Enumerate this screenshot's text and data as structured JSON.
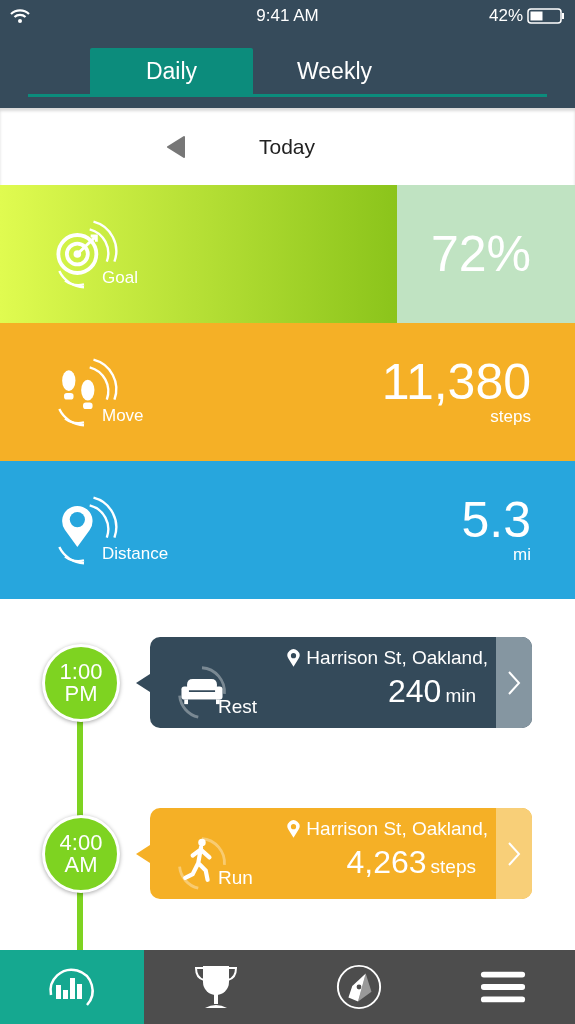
{
  "status_bar": {
    "time": "9:41 AM",
    "battery": "42%"
  },
  "tabs": [
    {
      "label": "Daily",
      "selected": true
    },
    {
      "label": "Weekly",
      "selected": false
    }
  ],
  "date_nav": {
    "label": "Today"
  },
  "metrics": [
    {
      "kind": "goal",
      "label": "Goal",
      "value": "72%",
      "level": 0.69
    },
    {
      "kind": "move",
      "label": "Move",
      "value": "11,380",
      "unit": "steps"
    },
    {
      "kind": "distance",
      "label": "Distance",
      "value": "5.3",
      "unit": "mi"
    }
  ],
  "timeline": [
    {
      "kind": "rest",
      "time": "1:00",
      "period": "PM",
      "label": "Rest",
      "location": "Harrison St, Oakland,",
      "value": "240",
      "unit": "min"
    },
    {
      "kind": "run",
      "time": "4:00",
      "period": "AM",
      "label": "Run",
      "location": "Harrison St, Oakland,",
      "value": "4,263",
      "unit": "steps"
    }
  ],
  "bottom_nav": [
    {
      "kind": "stats",
      "selected": true
    },
    {
      "kind": "trophy",
      "selected": false
    },
    {
      "kind": "compass",
      "selected": false
    },
    {
      "kind": "menu",
      "selected": false
    }
  ]
}
